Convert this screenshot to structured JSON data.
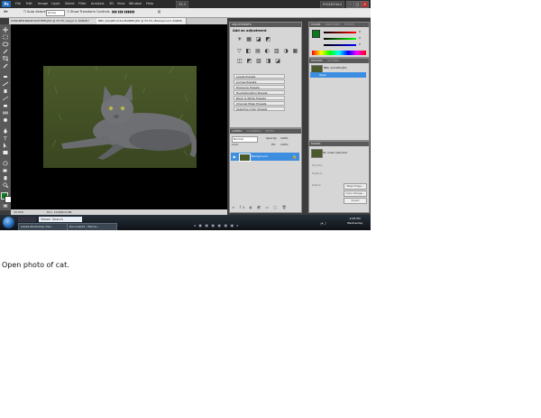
{
  "app": {
    "logo": "Ps",
    "workspace": "ESSENTIALS",
    "zoom": "33.3"
  },
  "menu": [
    "File",
    "Edit",
    "Image",
    "Layer",
    "Select",
    "Filter",
    "Analysis",
    "3D",
    "View",
    "Window",
    "Help"
  ],
  "options_bar": {
    "auto_select_label": "Auto-Select:",
    "auto_select_value": "Group",
    "transform_label": "Show Transform Controls"
  },
  "doc_tabs": [
    "9386-BEN-BRADY-ROTIFER.JPG @ 33.3% (Layer 0, RGB/8)*",
    "BBC_SCALED-9.5A-MAINER.JPG @ 33.3% (Background, RGB/8)"
  ],
  "status": {
    "zoom": "33.33%",
    "doc": "Doc: 10.9M/10.9M"
  },
  "adjustments": {
    "tab": "ADJUSTMENTS",
    "title": "Add an adjustment",
    "presets": [
      "Levels Presets",
      "Curves Presets",
      "Exposure Presets",
      "Hue/Saturation Presets",
      "Black & White Presets",
      "Channel Mixer Presets",
      "Selective Color Presets"
    ]
  },
  "layers": {
    "tabs": [
      "LAYERS",
      "CHANNELS",
      "PATHS"
    ],
    "blend": "Normal",
    "opacity_label": "Opacity:",
    "opacity": "100%",
    "fill_label": "Fill:",
    "fill": "100%",
    "lock_label": "Lock:",
    "layer_name": "Background"
  },
  "color_panel": {
    "tabs": [
      "COLOR",
      "SWATCHES",
      "STYLES"
    ],
    "r": "0",
    "g": "0",
    "b": "0"
  },
  "history_panel": {
    "tabs": [
      "HISTORY",
      "ACTIONS"
    ],
    "file": "BBC_SCALED.JPG",
    "item": "Open"
  },
  "masks_panel": {
    "tab": "MASKS",
    "status": "No mask selected",
    "labels": [
      "Density:",
      "Feather:",
      "Refine:"
    ],
    "buttons": [
      "Mask Edge...",
      "Color Range...",
      "Invert"
    ]
  },
  "taskbar": {
    "search_placeholder": "Yahoo! Search",
    "buttons": [
      "Adobe Photoshop CS4...",
      "Document1 - Micros..."
    ],
    "time": "4:08 PM",
    "day": "Wednesday"
  },
  "caption": "Open photo of cat.",
  "colors": {
    "accent": "#3d8ee0",
    "foreground": "#0a7a1a",
    "background": "#ffffff"
  }
}
